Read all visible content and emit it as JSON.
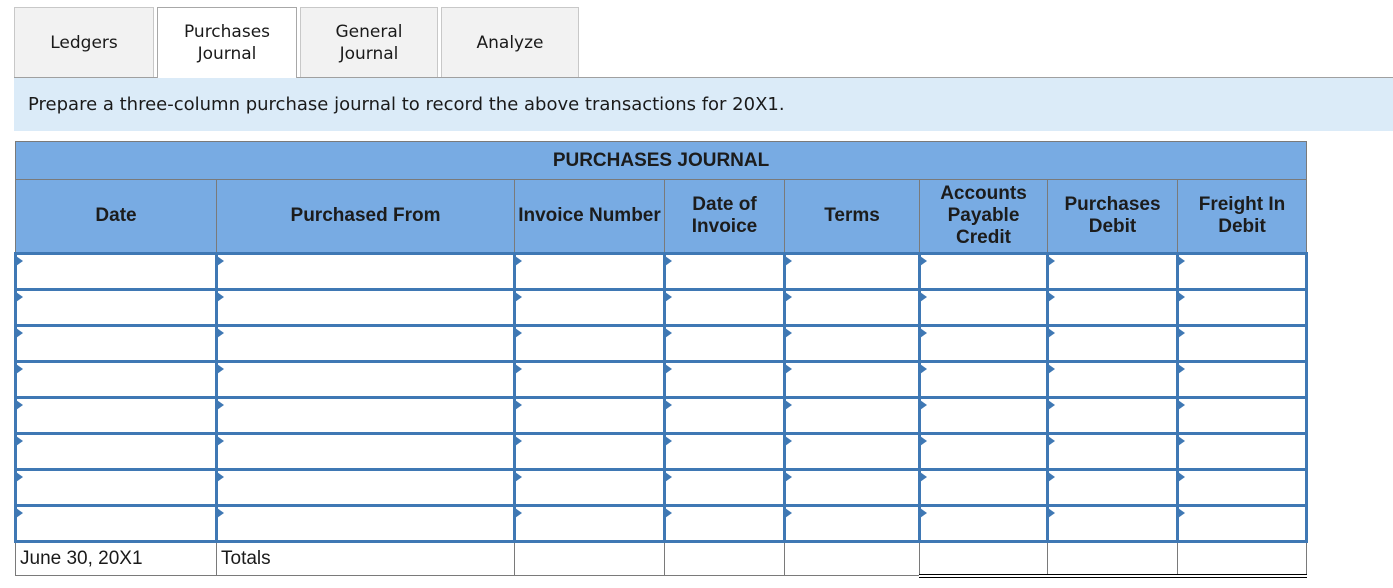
{
  "tabs": [
    {
      "label": "Ledgers",
      "active": false
    },
    {
      "label": "Purchases\nJournal",
      "active": true
    },
    {
      "label": "General\nJournal",
      "active": false
    },
    {
      "label": "Analyze",
      "active": false
    }
  ],
  "instruction": "Prepare a three-column purchase journal to record the above transactions for 20X1.",
  "journal": {
    "title": "PURCHASES JOURNAL",
    "columns": [
      "Date",
      "Purchased From",
      "Invoice Number",
      "Date of Invoice",
      "Terms",
      "Accounts Payable Credit",
      "Purchases Debit",
      "Freight In Debit"
    ],
    "rows": [
      [
        "",
        "",
        "",
        "",
        "",
        "",
        "",
        ""
      ],
      [
        "",
        "",
        "",
        "",
        "",
        "",
        "",
        ""
      ],
      [
        "",
        "",
        "",
        "",
        "",
        "",
        "",
        ""
      ],
      [
        "",
        "",
        "",
        "",
        "",
        "",
        "",
        ""
      ],
      [
        "",
        "",
        "",
        "",
        "",
        "",
        "",
        ""
      ],
      [
        "",
        "",
        "",
        "",
        "",
        "",
        "",
        ""
      ],
      [
        "",
        "",
        "",
        "",
        "",
        "",
        "",
        ""
      ],
      [
        "",
        "",
        "",
        "",
        "",
        "",
        "",
        ""
      ]
    ],
    "totals": {
      "date": "June 30, 20X1",
      "label": "Totals",
      "accounts_payable_credit": "",
      "purchases_debit": "",
      "freight_in_debit": ""
    }
  },
  "colors": {
    "header_bg": "#78abe3",
    "input_border": "#3f78b4",
    "instruction_bg": "#dbebf8",
    "tab_bg": "#f2f2f2"
  }
}
